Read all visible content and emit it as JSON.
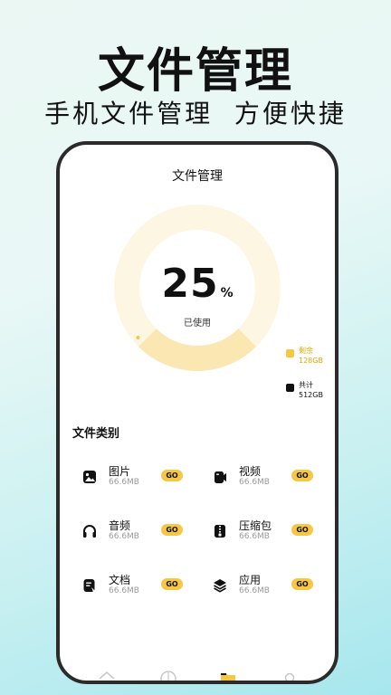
{
  "promo": {
    "headline": "文件管理",
    "subheadline": "手机文件管理  方便快捷"
  },
  "screen": {
    "title": "文件管理",
    "storage": {
      "used_percent": "25",
      "percent_unit": "%",
      "used_label": "已使用",
      "used_fraction": 0.25,
      "remaining_label": "剩余",
      "remaining_value": "128GB",
      "total_label": "共计",
      "total_value": "512GB"
    },
    "categories_title": "文件类别",
    "categories": [
      {
        "name": "图片",
        "size": "66.6MB",
        "action": "GO",
        "icon": "image-icon"
      },
      {
        "name": "视频",
        "size": "66.6MB",
        "action": "GO",
        "icon": "video-icon"
      },
      {
        "name": "音频",
        "size": "66.6MB",
        "action": "GO",
        "icon": "headphones-icon"
      },
      {
        "name": "压缩包",
        "size": "66.6MB",
        "action": "GO",
        "icon": "zip-icon"
      },
      {
        "name": "文档",
        "size": "66.6MB",
        "action": "GO",
        "icon": "document-icon"
      },
      {
        "name": "应用",
        "size": "66.6MB",
        "action": "GO",
        "icon": "layers-icon"
      }
    ],
    "tabbar": [
      "home-icon",
      "compass-icon",
      "folder-icon",
      "profile-icon"
    ]
  },
  "colors": {
    "accent": "#f6c744",
    "donut_light": "#fdf6e3",
    "donut_used": "#fbe7b2"
  }
}
